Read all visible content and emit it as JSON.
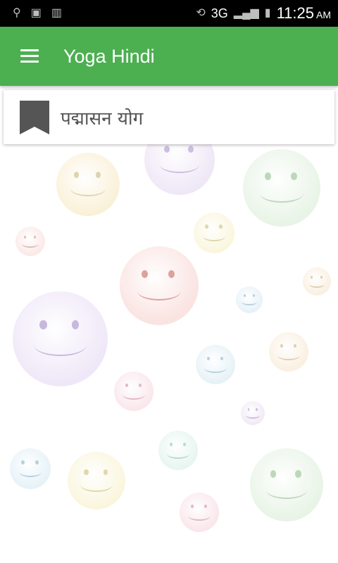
{
  "status_bar": {
    "network": "3G",
    "time": "11:25",
    "ampm": "AM"
  },
  "app_bar": {
    "title": "Yoga Hindi"
  },
  "card": {
    "title": "पद्मासन योग"
  },
  "colors": {
    "app_bar": "#4caf50",
    "status_bar": "#000000",
    "bookmark": "#555555"
  }
}
